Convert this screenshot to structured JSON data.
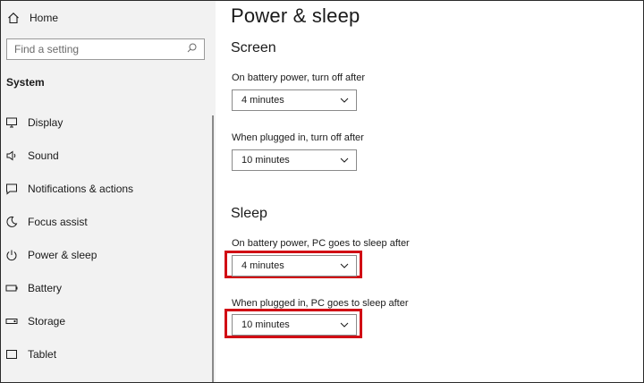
{
  "sidebar": {
    "home_label": "Home",
    "search_placeholder": "Find a setting",
    "section_label": "System",
    "items": [
      {
        "label": "Display",
        "icon": "monitor-icon"
      },
      {
        "label": "Sound",
        "icon": "speaker-icon"
      },
      {
        "label": "Notifications & actions",
        "icon": "notification-icon"
      },
      {
        "label": "Focus assist",
        "icon": "moon-icon"
      },
      {
        "label": "Power & sleep",
        "icon": "power-icon"
      },
      {
        "label": "Battery",
        "icon": "battery-icon"
      },
      {
        "label": "Storage",
        "icon": "storage-icon"
      },
      {
        "label": "Tablet",
        "icon": "tablet-icon"
      }
    ]
  },
  "main": {
    "title": "Power & sleep",
    "screen": {
      "heading": "Screen",
      "battery_label": "On battery power, turn off after",
      "battery_value": "4 minutes",
      "plugged_label": "When plugged in, turn off after",
      "plugged_value": "10 minutes"
    },
    "sleep": {
      "heading": "Sleep",
      "battery_label": "On battery power, PC goes to sleep after",
      "battery_value": "4 minutes",
      "plugged_label": "When plugged in, PC goes to sleep after",
      "plugged_value": "10 minutes"
    }
  },
  "colors": {
    "sidebar_bg": "#f2f2f2",
    "highlight": "#d10d14"
  }
}
